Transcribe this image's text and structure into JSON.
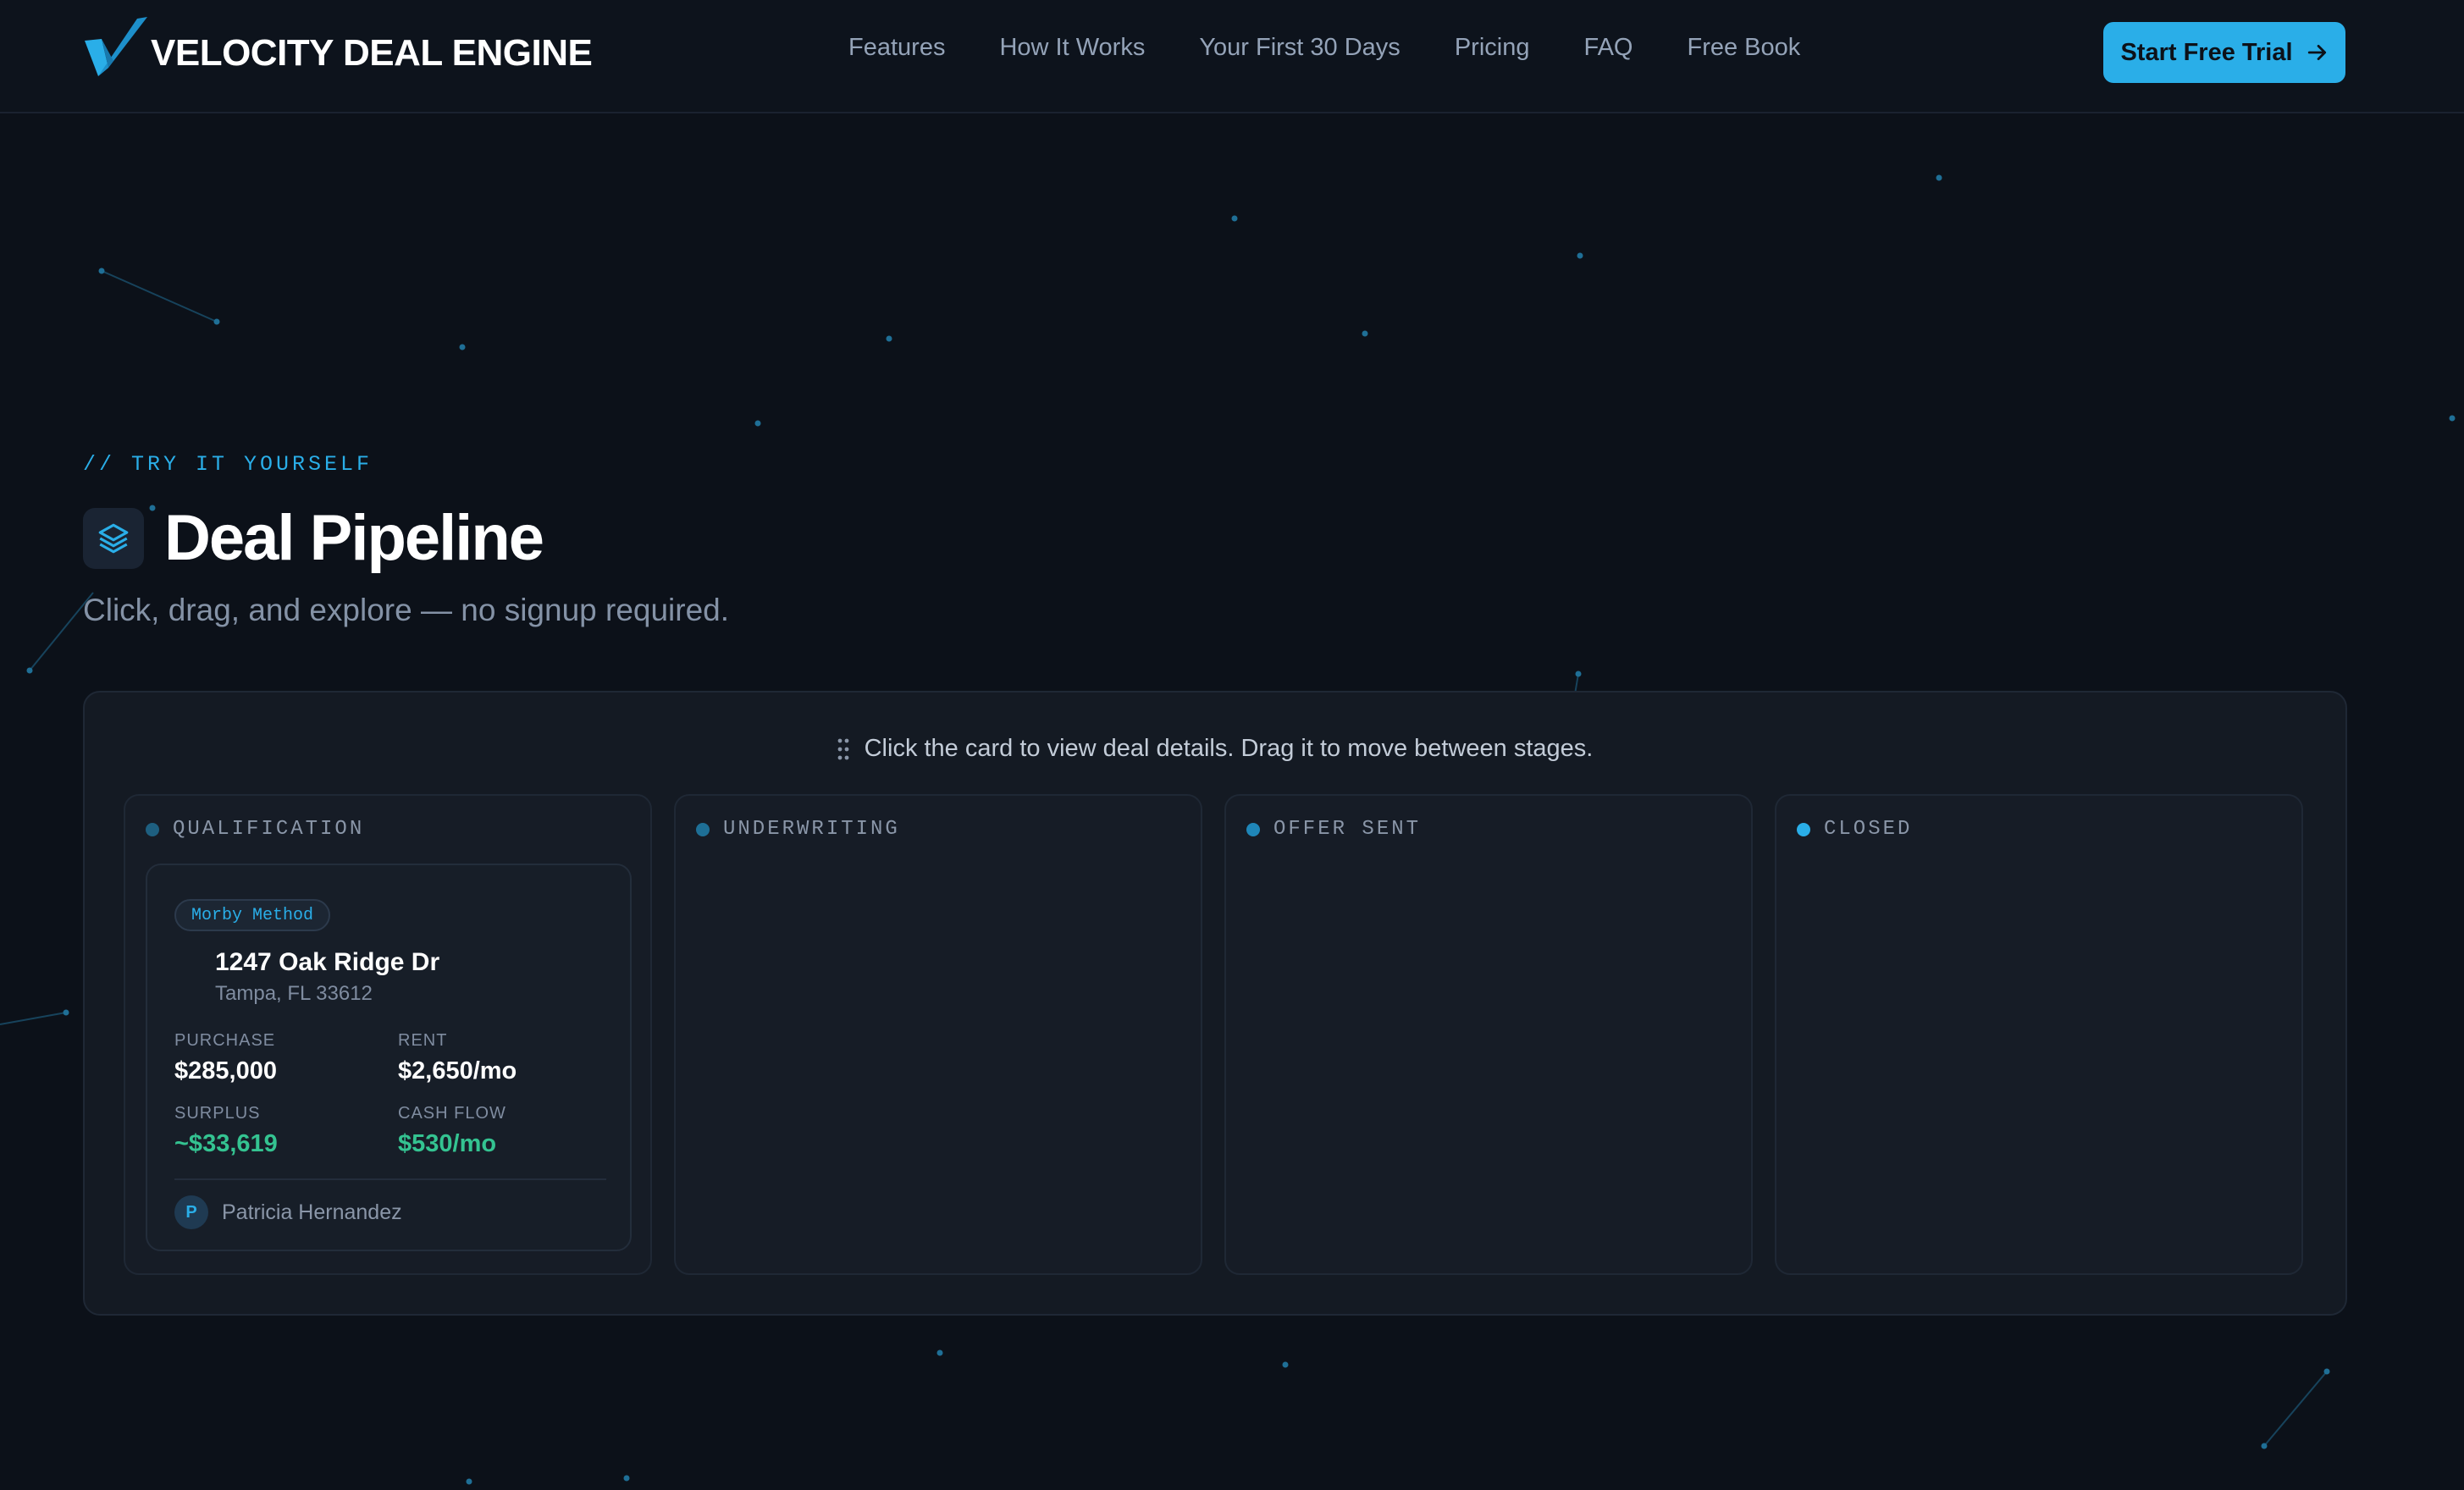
{
  "header": {
    "logo_text": "VELOCITY DEAL ENGINE",
    "nav": [
      "Features",
      "How It Works",
      "Your First 30 Days",
      "Pricing",
      "FAQ",
      "Free Book"
    ],
    "cta_label": "Start Free Trial"
  },
  "hero": {
    "eyebrow": "// TRY IT YOURSELF",
    "title": "Deal Pipeline",
    "subtitle": "Click, drag, and explore — no signup required."
  },
  "board": {
    "hint": "Click the card to view deal details. Drag it to move between stages.",
    "columns": [
      {
        "label": "QUALIFICATION",
        "dot_color": "#1e5f80"
      },
      {
        "label": "UNDERWRITING",
        "dot_color": "#1e6f96"
      },
      {
        "label": "OFFER SENT",
        "dot_color": "#1f86b8"
      },
      {
        "label": "CLOSED",
        "dot_color": "#2aaee8"
      }
    ],
    "card": {
      "tag": "Morby Method",
      "address": "1247 Oak Ridge Dr",
      "city": "Tampa, FL 33612",
      "purchase_label": "PURCHASE",
      "purchase_value": "$285,000",
      "rent_label": "RENT",
      "rent_value": "$2,650/mo",
      "surplus_label": "SURPLUS",
      "surplus_value": "~$33,619",
      "cashflow_label": "CASH FLOW",
      "cashflow_value": "$530/mo",
      "owner_initial": "P",
      "owner_name": "Patricia Hernandez"
    }
  },
  "colors": {
    "background": "#0c1119",
    "accent": "#2aaee8",
    "positive": "#34c391"
  }
}
